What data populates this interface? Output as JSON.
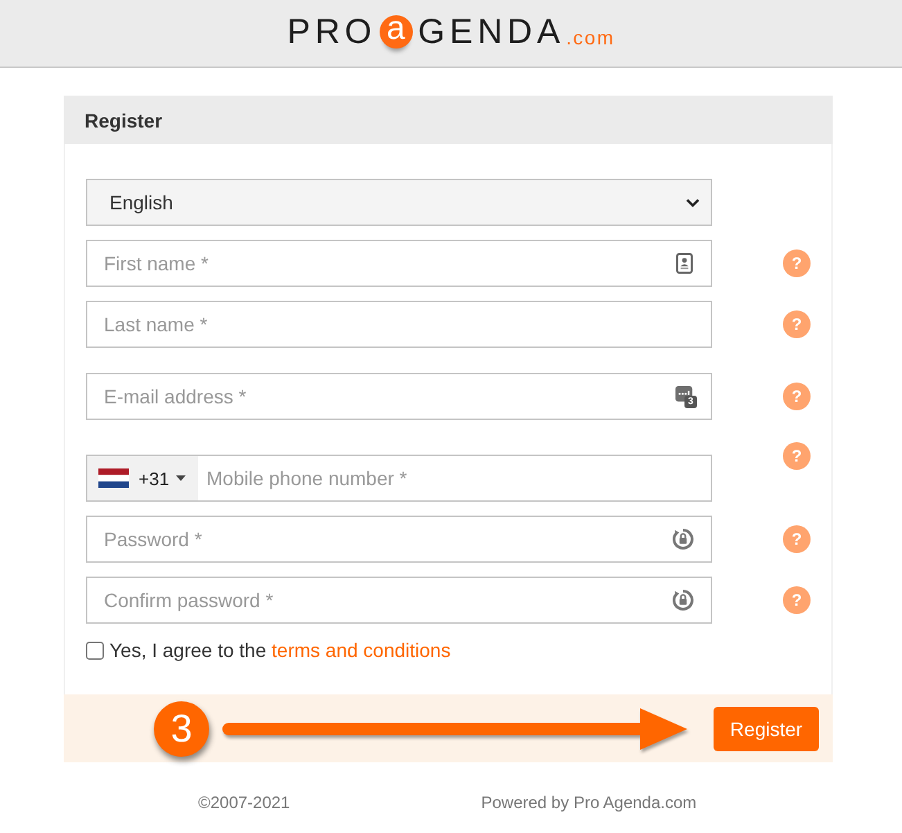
{
  "header": {
    "logo": {
      "prefix": "PRO",
      "mark": "a",
      "rest": "GENDA",
      "suffix": ".com"
    }
  },
  "card": {
    "title": "Register"
  },
  "language_select": {
    "value": "English"
  },
  "fields": [
    {
      "kind": "contact",
      "placeholder": "First name *",
      "help": "?"
    },
    {
      "kind": "plain",
      "placeholder": "Last name *",
      "help": "?"
    },
    {
      "kind": "email",
      "placeholder": "E-mail address *",
      "icon_badge": "3",
      "help": "?"
    },
    {
      "kind": "phone",
      "country_code": "+31",
      "placeholder": "Mobile phone number *",
      "help": "?"
    },
    {
      "kind": "password",
      "placeholder": "Password *",
      "help": "?"
    },
    {
      "kind": "password",
      "placeholder": "Confirm password *",
      "help": "?"
    }
  ],
  "agreement": {
    "checked": false,
    "text": "Yes, I agree to the ",
    "link": "terms and conditions"
  },
  "card_footer": {
    "step": "3",
    "button": "Register"
  },
  "page_footer": {
    "copyright": "©2007-2021",
    "powered_by": "Powered by Pro Agenda.com"
  }
}
